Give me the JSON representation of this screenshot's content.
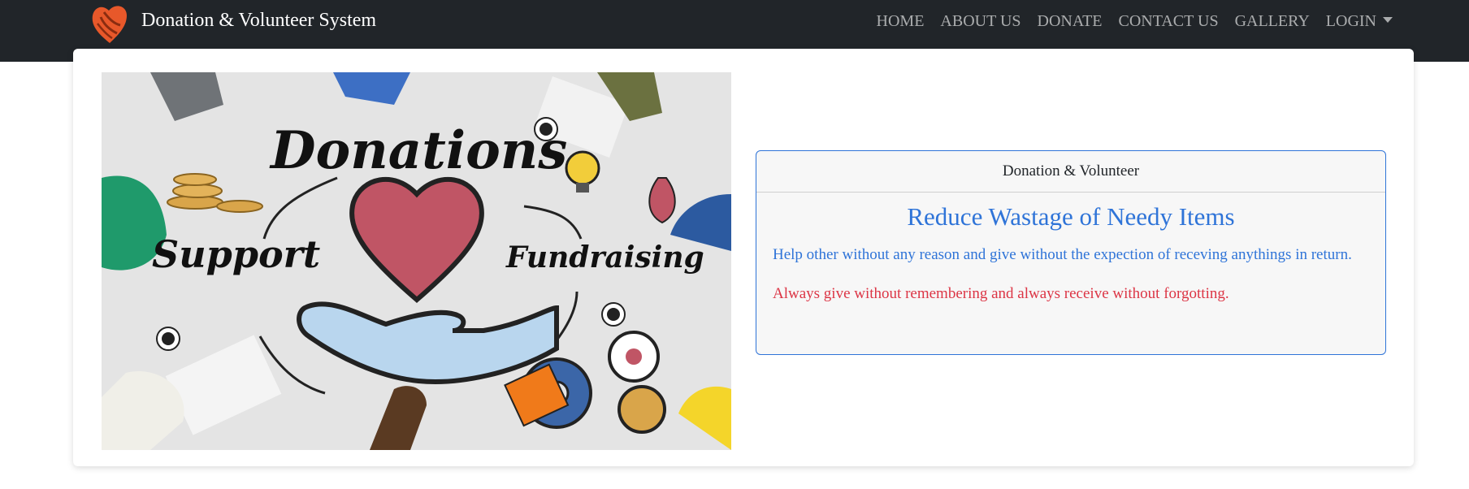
{
  "navbar": {
    "brand": "Donation & Volunteer System",
    "logo_icon": "heart-hands-icon",
    "items": [
      {
        "label": "HOME"
      },
      {
        "label": "ABOUT US"
      },
      {
        "label": "DONATE"
      },
      {
        "label": "CONTACT US"
      },
      {
        "label": "GALLERY"
      },
      {
        "label": "LOGIN"
      }
    ]
  },
  "hero": {
    "words": [
      "Donations",
      "Support",
      "Fundraising"
    ]
  },
  "info_card": {
    "header": "Donation & Volunteer",
    "title": "Reduce Wastage of Needy Items",
    "text1": "Help other without any reason and give without the expection of receving anythings in return.",
    "text2": "Always give without remembering and always receive without forgotting."
  },
  "colors": {
    "navbar_bg": "#212529",
    "accent_blue": "#2f74d8",
    "accent_red": "#dc3545",
    "heart": "#c05565",
    "logo": "#e8582a"
  }
}
